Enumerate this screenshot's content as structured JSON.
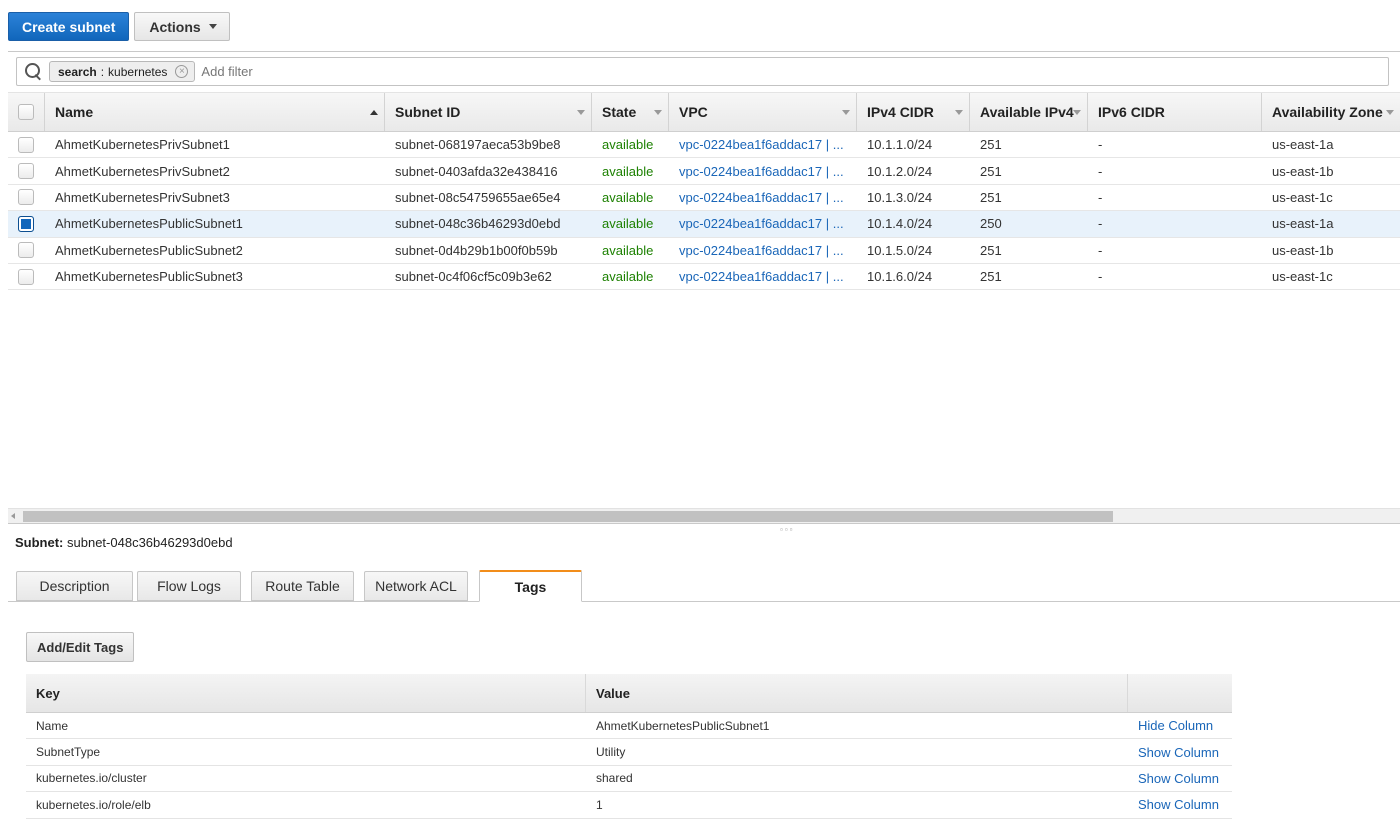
{
  "toolbar": {
    "create_label": "Create subnet",
    "actions_label": "Actions"
  },
  "filter": {
    "token_key": "search",
    "token_sep": " : ",
    "token_value": "kubernetes",
    "placeholder": "Add filter"
  },
  "grid": {
    "columns": [
      "Name",
      "Subnet ID",
      "State",
      "VPC",
      "IPv4 CIDR",
      "Available IPv4",
      "IPv6 CIDR",
      "Availability Zone"
    ],
    "rows": [
      {
        "name": "AhmetKubernetesPrivSubnet1",
        "subnet_id": "subnet-068197aeca53b9be8",
        "state": "available",
        "vpc": "vpc-0224bea1f6addac17 | ...",
        "ipv4": "10.1.1.0/24",
        "available": "251",
        "ipv6": "-",
        "az": "us-east-1a",
        "selected": false
      },
      {
        "name": "AhmetKubernetesPrivSubnet2",
        "subnet_id": "subnet-0403afda32e438416",
        "state": "available",
        "vpc": "vpc-0224bea1f6addac17 | ...",
        "ipv4": "10.1.2.0/24",
        "available": "251",
        "ipv6": "-",
        "az": "us-east-1b",
        "selected": false
      },
      {
        "name": "AhmetKubernetesPrivSubnet3",
        "subnet_id": "subnet-08c54759655ae65e4",
        "state": "available",
        "vpc": "vpc-0224bea1f6addac17 | ...",
        "ipv4": "10.1.3.0/24",
        "available": "251",
        "ipv6": "-",
        "az": "us-east-1c",
        "selected": false
      },
      {
        "name": "AhmetKubernetesPublicSubnet1",
        "subnet_id": "subnet-048c36b46293d0ebd",
        "state": "available",
        "vpc": "vpc-0224bea1f6addac17 | ...",
        "ipv4": "10.1.4.0/24",
        "available": "250",
        "ipv6": "-",
        "az": "us-east-1a",
        "selected": true
      },
      {
        "name": "AhmetKubernetesPublicSubnet2",
        "subnet_id": "subnet-0d4b29b1b00f0b59b",
        "state": "available",
        "vpc": "vpc-0224bea1f6addac17 | ...",
        "ipv4": "10.1.5.0/24",
        "available": "251",
        "ipv6": "-",
        "az": "us-east-1b",
        "selected": false
      },
      {
        "name": "AhmetKubernetesPublicSubnet3",
        "subnet_id": "subnet-0c4f06cf5c09b3e62",
        "state": "available",
        "vpc": "vpc-0224bea1f6addac17 | ...",
        "ipv4": "10.1.6.0/24",
        "available": "251",
        "ipv6": "-",
        "az": "us-east-1c",
        "selected": false
      }
    ]
  },
  "detail": {
    "title_label": "Subnet:",
    "title_value": "subnet-048c36b46293d0ebd",
    "tabs": [
      "Description",
      "Flow Logs",
      "Route Table",
      "Network ACL",
      "Tags"
    ],
    "active_tab": "Tags",
    "add_tags_label": "Add/Edit Tags",
    "tags_columns": [
      "Key",
      "Value"
    ],
    "tags": [
      {
        "key": "Name",
        "value": "AhmetKubernetesPublicSubnet1",
        "action": "Hide Column"
      },
      {
        "key": "SubnetType",
        "value": "Utility",
        "action": "Show Column"
      },
      {
        "key": "kubernetes.io/cluster",
        "value": "shared",
        "action": "Show Column"
      },
      {
        "key": "kubernetes.io/role/elb",
        "value": "1",
        "action": "Show Column"
      }
    ]
  },
  "icons": {
    "search": "search-icon",
    "remove_token": "close-icon",
    "dropdown": "chevron-down-icon",
    "sort": "sort-icon"
  },
  "colors": {
    "primary": "#1166bb",
    "state_available": "#1d8102",
    "link": "#1a66b8",
    "active_tab_accent": "#f28d1a"
  }
}
